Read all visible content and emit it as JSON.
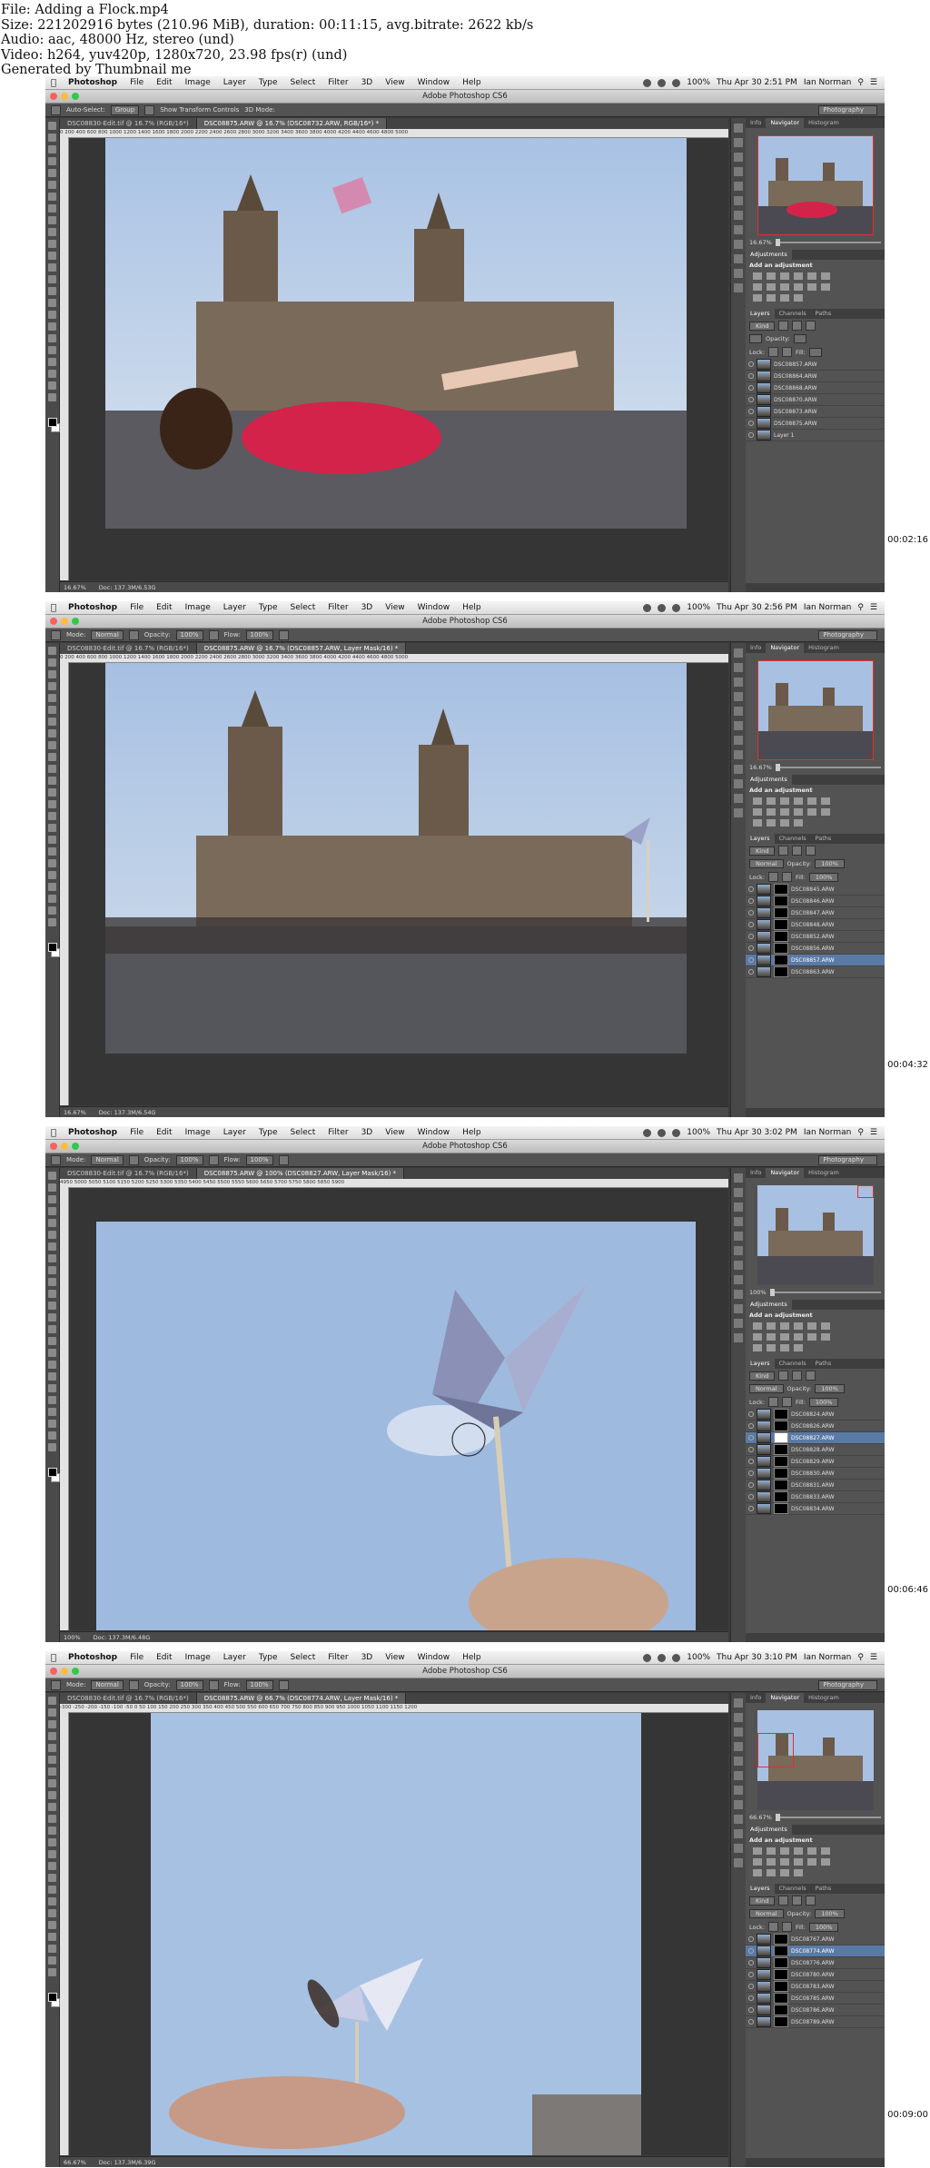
{
  "file_info": {
    "file": "File: Adding a Flock.mp4",
    "size": "Size: 221202916 bytes (210.96 MiB), duration: 00:11:15, avg.bitrate: 2622 kb/s",
    "audio": "Audio: aac, 48000 Hz, stereo (und)",
    "video": "Video: h264, yuv420p, 1280x720, 23.98 fps(r) (und)",
    "generator": "Generated by Thumbnail me"
  },
  "menubar": {
    "app": "Photoshop",
    "items": [
      "File",
      "Edit",
      "Image",
      "Layer",
      "Type",
      "Select",
      "Filter",
      "3D",
      "View",
      "Window",
      "Help"
    ],
    "battery": "100%",
    "user": "Ian Norman"
  },
  "window_title": "Adobe Photoshop CS6",
  "workspace": "Photography",
  "panels": {
    "tabs": [
      "Info",
      "Navigator",
      "Histogram"
    ],
    "adjustments_title": "Adjustments",
    "add_adjustment": "Add an adjustment",
    "layers_tabs": [
      "Layers",
      "Channels",
      "Paths"
    ],
    "kind": "Kind",
    "lock_label": "Lock:",
    "opacity_label": "Opacity:",
    "fill_label": "Fill:"
  },
  "frames": [
    {
      "timestamp": "00:02:16",
      "clock": "Thu Apr 30  2:51 PM",
      "options": {
        "auto_select": "Auto-Select:",
        "group": "Group",
        "transform": "Show Transform Controls",
        "mode3d": "3D Mode:"
      },
      "tabs": [
        "DSC08830-Edit.tif @ 16.7% (RGB/16*)",
        "DSC08875.ARW @ 16.7% (DSC08732.ARW, RGB/16*) *"
      ],
      "ruler": "0    200   400   600   800   1000  1200  1400  1600  1800  2000  2200  2400  2600  2800  3000  3200  3400  3600  3800  4000  4200  4400  4600  4800  5000",
      "zoom": "16.67%",
      "doc": "Doc: 137.3M/6.53G",
      "layers": [
        "DSC08857.ARW",
        "DSC08864.ARW",
        "DSC08868.ARW",
        "DSC08870.ARW",
        "DSC08873.ARW",
        "DSC08875.ARW",
        "Layer 1"
      ],
      "selected_layer": -1,
      "opacity": "",
      "fill": ""
    },
    {
      "timestamp": "00:04:32",
      "clock": "Thu Apr 30  2:56 PM",
      "options": {
        "mode_label": "Mode:",
        "mode": "Normal",
        "opacity_label": "Opacity:",
        "opacity": "100%",
        "flow_label": "Flow:",
        "flow": "100%"
      },
      "tabs": [
        "DSC08830-Edit.tif @ 16.7% (RGB/16*)",
        "DSC08875.ARW @ 16.7% (DSC08857.ARW, Layer Mask/16) *"
      ],
      "ruler": "0    200   400   600   800   1000  1200  1400  1600  1800  2000  2200  2400  2600  2800  3000  3200  3400  3600  3800  4000  4200  4400  4600  4800  5000",
      "zoom": "16.67%",
      "doc": "Doc: 137.3M/6.54G",
      "layers": [
        "DSC08845.ARW",
        "DSC08846.ARW",
        "DSC08847.ARW",
        "DSC08848.ARW",
        "DSC08852.ARW",
        "DSC08856.ARW",
        "DSC08857.ARW",
        "DSC08863.ARW"
      ],
      "selected_layer": 6,
      "blend": "Normal",
      "opacity": "100%",
      "fill": "100%"
    },
    {
      "timestamp": "00:06:46",
      "clock": "Thu Apr 30  3:02 PM",
      "options": {
        "mode_label": "Mode:",
        "mode": "Normal",
        "opacity_label": "Opacity:",
        "opacity": "100%",
        "flow_label": "Flow:",
        "flow": "100%"
      },
      "tabs": [
        "DSC08830-Edit.tif @ 16.7% (RGB/16*)",
        "DSC08875.ARW @ 100% (DSC08827.ARW, Layer Mask/16) *"
      ],
      "ruler": "4950   5000   5050   5100   5150   5200   5250   5300   5350   5400   5450   5500   5550   5600   5650   5700   5750   5800   5850   5900",
      "zoom": "100%",
      "doc": "Doc: 137.3M/6.48G",
      "layers": [
        "DSC08824.ARW",
        "DSC08826.ARW",
        "DSC08827.ARW",
        "DSC08828.ARW",
        "DSC08829.ARW",
        "DSC08830.ARW",
        "DSC08831.ARW",
        "DSC08833.ARW",
        "DSC08834.ARW"
      ],
      "selected_layer": 2,
      "blend": "Normal",
      "opacity": "100%",
      "fill": "100%"
    },
    {
      "timestamp": "00:09:00",
      "clock": "Thu Apr 30  3:10 PM",
      "options": {
        "mode_label": "Mode:",
        "mode": "Normal",
        "opacity_label": "Opacity:",
        "opacity": "100%",
        "flow_label": "Flow:",
        "flow": "100%"
      },
      "tabs": [
        "DSC08830-Edit.tif @ 16.7% (RGB/16*)",
        "DSC08875.ARW @ 66.7% (DSC08774.ARW, Layer Mask/16) *"
      ],
      "ruler": "-300  -250  -200  -150  -100  -50   0     50    100   150   200   250   300   350   400   450   500   550   600   650   700   750   800   850   900   950   1000  1050  1100  1150  1200",
      "zoom": "66.67%",
      "doc": "Doc: 137.3M/6.39G",
      "layers": [
        "DSC08767.ARW",
        "DSC08774.ARW",
        "DSC08776.ARW",
        "DSC08780.ARW",
        "DSC08783.ARW",
        "DSC08785.ARW",
        "DSC08786.ARW",
        "DSC08789.ARW"
      ],
      "selected_layer": 1,
      "blend": "Normal",
      "opacity": "100%",
      "fill": "100%"
    }
  ]
}
